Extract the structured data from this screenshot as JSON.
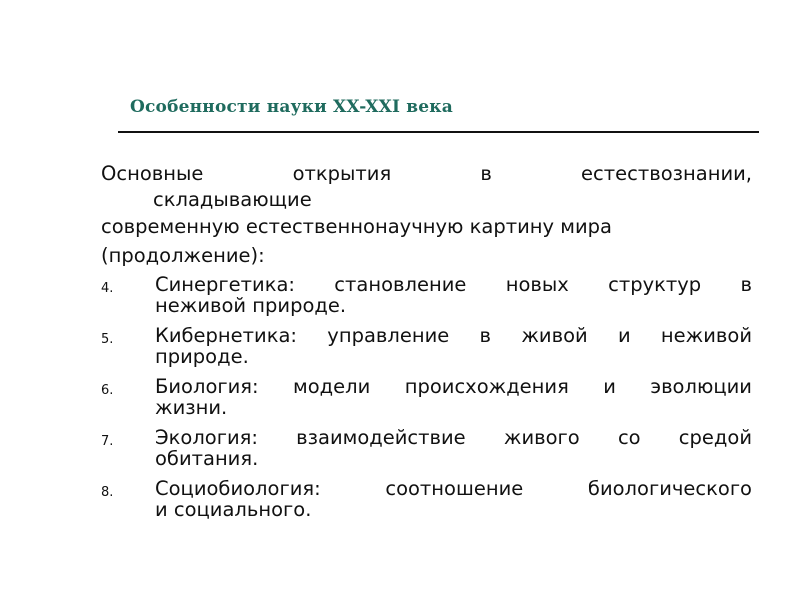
{
  "slide": {
    "title": "Особенности науки XX-XXI века",
    "intro": {
      "line1": "Основные открытия в естествознании,",
      "line1_wrap": "складывающие",
      "line2": "современную естественнонаучную картину мира",
      "line3": "(продолжение):"
    },
    "items": [
      {
        "number": "4.",
        "line1": "Синергетика: становление новых структур в",
        "line2": "неживой природе."
      },
      {
        "number": "5.",
        "line1": "Кибернетика: управление в живой и неживой",
        "line2": "природе."
      },
      {
        "number": "6.",
        "line1": "Биология: модели происхождения и эволюции",
        "line2": "жизни."
      },
      {
        "number": "7.",
        "line1": "Экология: взаимодействие живого со средой",
        "line2": "обитания."
      },
      {
        "number": "8.",
        "line1": "Социобиология: соотношение биологического",
        "line2": "и социального."
      }
    ]
  }
}
